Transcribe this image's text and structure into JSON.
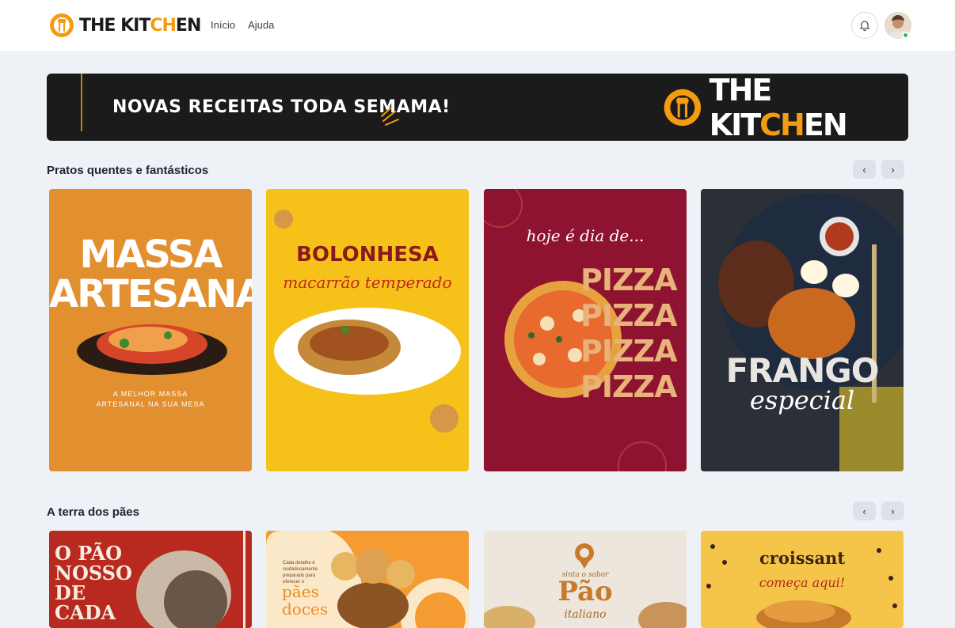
{
  "header": {
    "logo": {
      "text_a": "THE KIT",
      "text_b": "CH",
      "text_c": "EN"
    },
    "nav": [
      {
        "label": "Início"
      },
      {
        "label": "Ajuda"
      }
    ],
    "bell_icon": "bell-icon",
    "avatar_status": "online"
  },
  "banner": {
    "headline": "NOVAS RECEITAS TODA SEMAMA!",
    "logo": {
      "text_a": "THE KIT",
      "text_b": "CH",
      "text_c": "EN"
    }
  },
  "colors": {
    "accent": "#f39c12",
    "page_bg": "#eef2f7",
    "banner_bg": "#1b1b1b",
    "online": "#22c55e"
  },
  "sections": [
    {
      "title": "Pratos quentes e fantásticos",
      "prev_label": "‹",
      "next_label": "›",
      "cards": [
        {
          "line1": "MASSA",
          "line2": "ARTESANAL",
          "sub1": "A MELHOR MASSA",
          "sub2": "ARTESANAL NA SUA MESA"
        },
        {
          "line1": "BOLONHESA",
          "line2": "macarrão temperado"
        },
        {
          "line1": "hoje é dia de...",
          "word": "PIZZA"
        },
        {
          "line1": "FRANGO",
          "line2": "especial"
        }
      ]
    },
    {
      "title": "A terra dos pães",
      "prev_label": "‹",
      "next_label": "›",
      "cards": [
        {
          "line1": "O PÃO",
          "line2": "NOSSO",
          "line3": "DE",
          "line4": "CADA"
        },
        {
          "small1": "Cada detalhe é",
          "small2": "cuidadosamente",
          "small3": "preparado para",
          "small4": "oferecer o",
          "line1": "pães",
          "line2": "doces"
        },
        {
          "top": "sinta o sabor",
          "line1": "Pão",
          "line2": "italiano"
        },
        {
          "line1": "croissant",
          "line2": "começa aqui!"
        }
      ]
    }
  ]
}
